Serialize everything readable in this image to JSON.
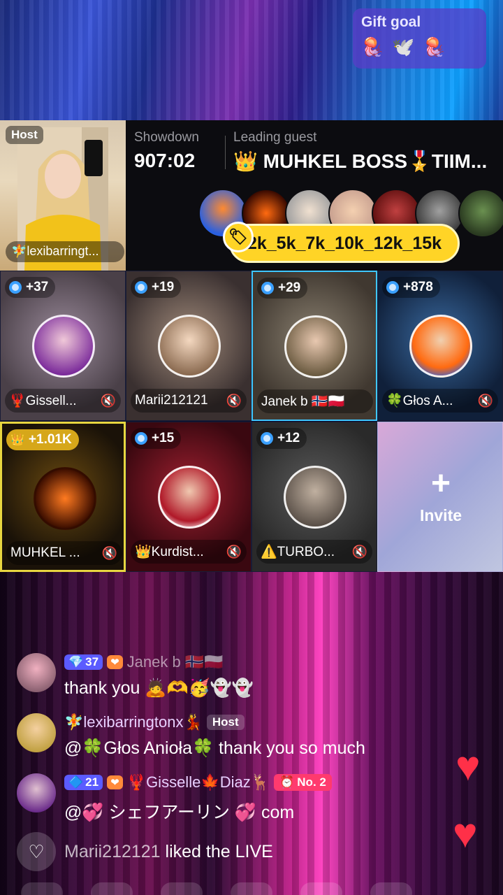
{
  "gift_goal": {
    "title": "Gift goal",
    "gifts": [
      "🪼",
      "🕊️",
      "🪼"
    ]
  },
  "host": {
    "badge": "Host",
    "name": "🧚lexibarringt..."
  },
  "showdown": {
    "label": "Showdown",
    "timer": "907:02",
    "leading_label": "Leading guest",
    "leading_name": "👑 MUHKEL BOSS🎖️TIIM...",
    "tag": "2k_5k_7k_10k_12k_15k"
  },
  "guests": [
    {
      "score": "+37",
      "name": "🦞Gissell...",
      "gold": false
    },
    {
      "score": "+19",
      "name": "Marii212121",
      "gold": false
    },
    {
      "score": "+29",
      "name": "Janek b 🇳🇴🇵🇱",
      "gold": false
    },
    {
      "score": "+878",
      "name": "🍀Głos A...",
      "gold": false
    },
    {
      "score": "+1.01K",
      "name": "MUHKEL ...",
      "gold": true
    },
    {
      "score": "+15",
      "name": "👑Kurdist...",
      "gold": false
    },
    {
      "score": "+12",
      "name": "⚠️TURBO...",
      "gold": false
    }
  ],
  "invite": {
    "plus": "+",
    "label": "Invite"
  },
  "comments": [
    {
      "level": "37",
      "name": "Janek b 🇳🇴🇵🇱",
      "text": "thank you 🙇🫶🥳👻👻"
    },
    {
      "name": "🧚lexibarringtonx💃",
      "chip": "Host",
      "text": "@🍀Głos Anioła🍀  thank you so much"
    },
    {
      "level": "21",
      "name": "🦞Gisselle🍁Diaz🦌",
      "rank": "No. 2",
      "text": "@💞 シェフアーリン 💞 com"
    }
  ],
  "liked": {
    "user": "Marii212121",
    "text": " liked the LIVE"
  }
}
